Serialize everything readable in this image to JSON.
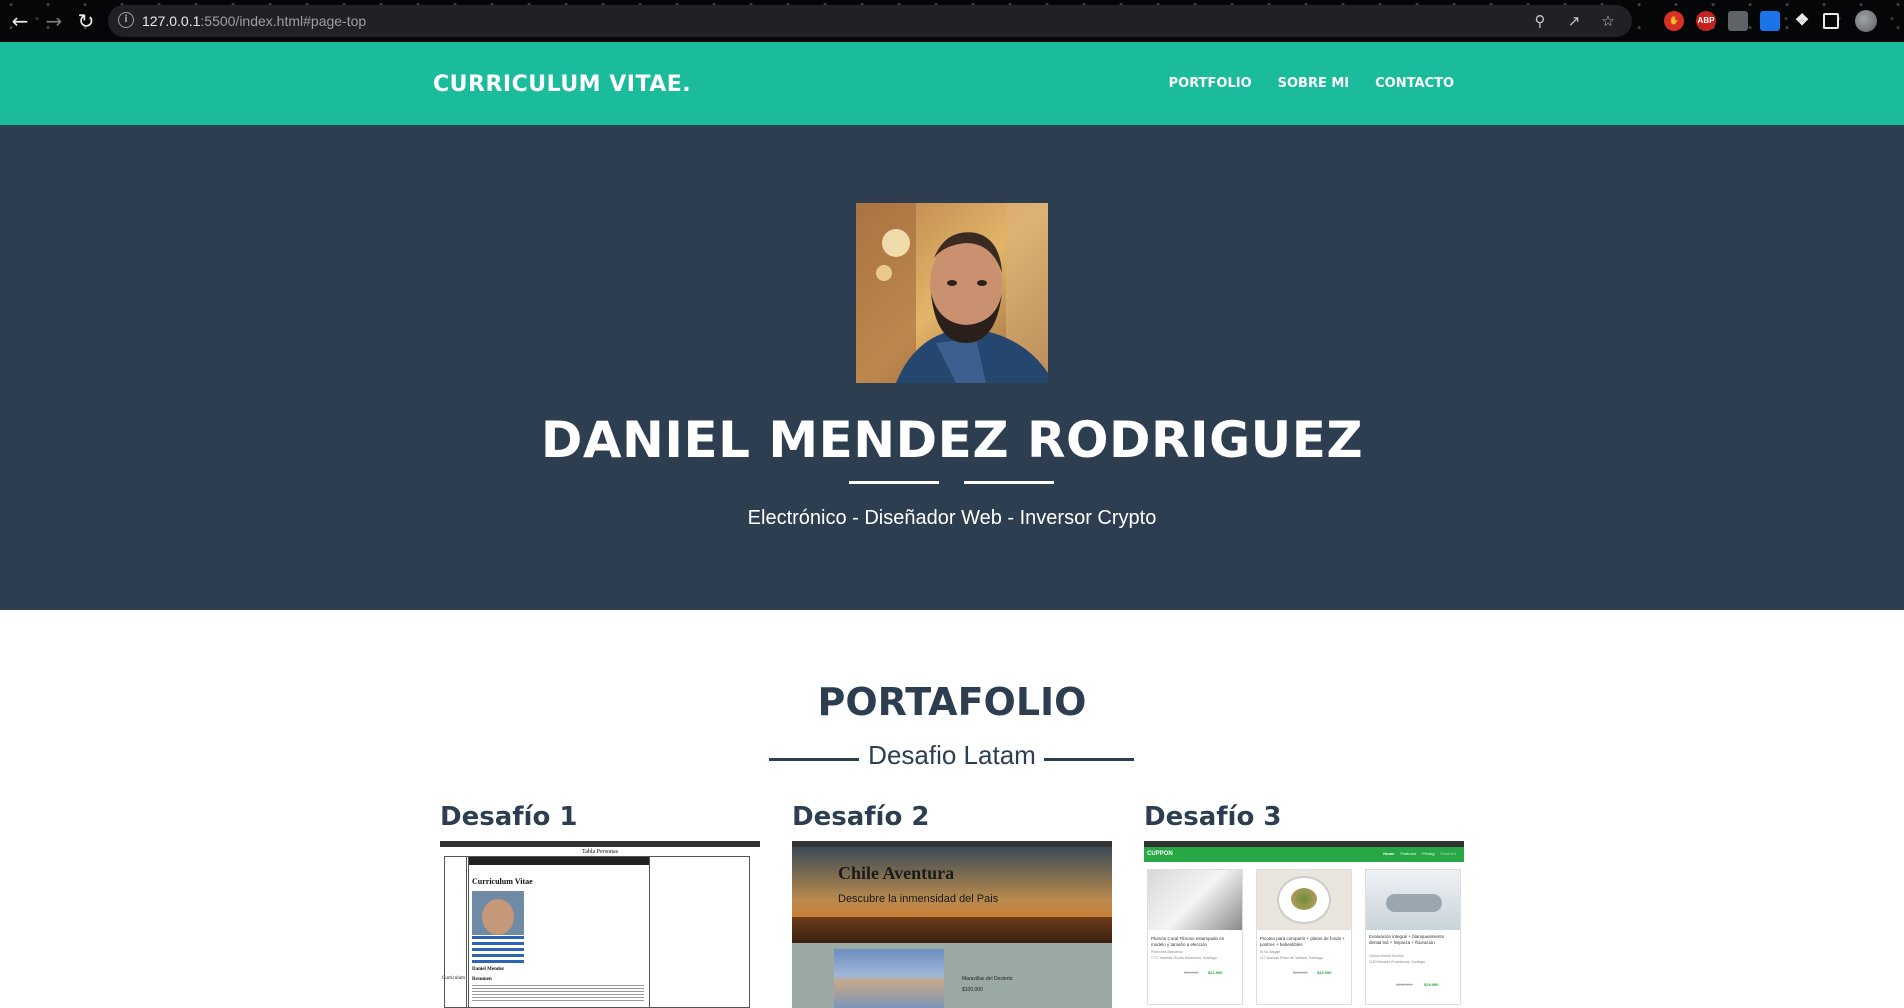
{
  "browser": {
    "url_host": "127.0.0.1",
    "url_rest": ":5500/index.html#page-top",
    "extensions": [
      "ABP"
    ]
  },
  "navbar": {
    "brand": "CURRICULUM VITAE.",
    "links": [
      "PORTFOLIO",
      "SOBRE MI",
      "CONTACTO"
    ],
    "color": "#1abc9c"
  },
  "hero": {
    "name": "DANIEL MENDEZ RODRIGUEZ",
    "subtitle": "Electrónico - Diseñador Web - Inversor Crypto",
    "color": "#2c3e50"
  },
  "portfolio": {
    "title": "PORTAFOLIO",
    "subtitle": "Desafio Latam",
    "cards": [
      {
        "title": "Desafío 1",
        "thumb": {
          "tab_title": "Tabla Personas",
          "heading": "Curriculum Vitae",
          "name": "Daniel Mendez",
          "section": "Resumen",
          "left_label": "Curriculum"
        }
      },
      {
        "title": "Desafío 2",
        "thumb": {
          "heading": "Chile Aventura",
          "tagline": "Descubre la inmensidad del Pais",
          "item_title": "Maravillas del Desierto",
          "item_price": "$100.000"
        }
      },
      {
        "title": "Desafío 3",
        "thumb": {
          "brand": "CUPPON",
          "nav": [
            "Home",
            "Features",
            "Pricing",
            "Disabled"
          ],
          "items": [
            {
              "desc": "Plumón Coral Fibroso estampado en modelo y tamaño a elección",
              "shop": "Plumones Marcelino",
              "loc": "7717 Avenida Vicuña Mackenna, Santiago",
              "old": "$45.990",
              "new": "$22.990"
            },
            {
              "desc": "Picoteo para compartir + platos de fondo + postres + bebestibles",
              "shop": "El Su Bagaje",
              "loc": "117 Avenida Pedro de Valdivia, Santiago",
              "old": "$30.990",
              "new": "$22.990"
            },
            {
              "desc": "Evaluación integral + blanqueamiento dental led + limpieza + flúoración",
              "shop": "Clínica Dental Sonrisa",
              "loc": "1180 Moneda Providencia, Santiago",
              "old": "$160.990",
              "new": "$29.990"
            }
          ]
        }
      }
    ]
  }
}
